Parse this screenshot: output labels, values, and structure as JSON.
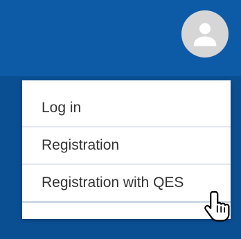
{
  "header": {
    "background_color": "#0d5aa7",
    "avatar_icon": "user-avatar-icon"
  },
  "menu": {
    "items": [
      {
        "label": "Log in"
      },
      {
        "label": "Registration"
      },
      {
        "label": "Registration with QES"
      }
    ]
  },
  "cursor": {
    "icon": "hand-pointer-cursor-icon"
  }
}
